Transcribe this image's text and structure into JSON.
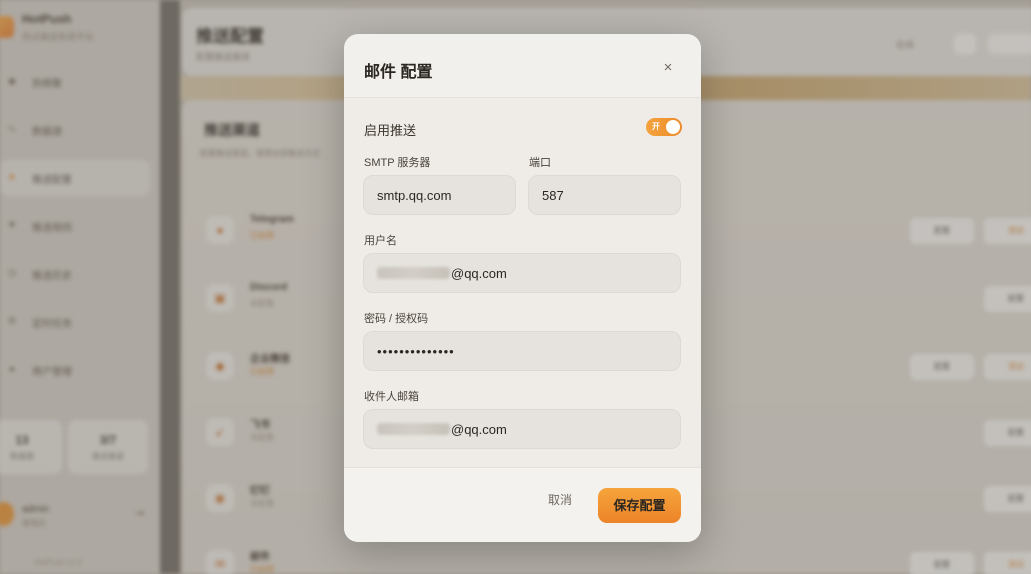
{
  "background": {
    "brand": {
      "name": "HotPush",
      "subtitle": "热点推送系统平台"
    },
    "nav": [
      "热榜聚",
      "数据源",
      "推送配置",
      "推送规则",
      "推送历史",
      "定时任务",
      "用户管理"
    ],
    "stats": [
      {
        "value": "13",
        "label": "数据源"
      },
      {
        "value": "3/7",
        "label": "推送渠道"
      }
    ],
    "user": {
      "name": "admin",
      "role": "管理员"
    },
    "sidebar_footer": "HotPush v1.0",
    "page": {
      "title": "推送配置",
      "subtitle": "配置推送渠道",
      "status": "在线"
    },
    "section": {
      "title": "推送渠道",
      "subtitle": "配置推送渠道，使用全部推送方式"
    },
    "channels": [
      {
        "name": "Telegram",
        "status": "已启用",
        "enabled": true
      },
      {
        "name": "Discord",
        "status": "未配置",
        "enabled": false
      },
      {
        "name": "企业微信",
        "status": "已启用",
        "enabled": true
      },
      {
        "name": "飞书",
        "status": "未配置",
        "enabled": false
      },
      {
        "name": "钉钉",
        "status": "未配置",
        "enabled": false
      },
      {
        "name": "邮件",
        "status": "已启用",
        "enabled": true
      }
    ],
    "buttons": {
      "config": "配置",
      "test": "测试"
    }
  },
  "modal": {
    "title": "邮件 配置",
    "close": "×",
    "enable": {
      "label": "启用推送",
      "toggle_text": "开",
      "on": true
    },
    "smtp_server": {
      "label": "SMTP 服务器",
      "value": "smtp.qq.com"
    },
    "port": {
      "label": "端口",
      "value": "587"
    },
    "username": {
      "label": "用户名",
      "value_suffix": "@qq.com"
    },
    "password": {
      "label": "密码 / 授权码",
      "value": "••••••••••••••"
    },
    "recipient": {
      "label": "收件人邮箱",
      "value_suffix": "@qq.com"
    },
    "cancel": "取消",
    "save": "保存配置"
  },
  "colors": {
    "accent": "#ec8a2c",
    "modal_bg": "#f2f0ed",
    "input_bg": "#e6e3de"
  }
}
